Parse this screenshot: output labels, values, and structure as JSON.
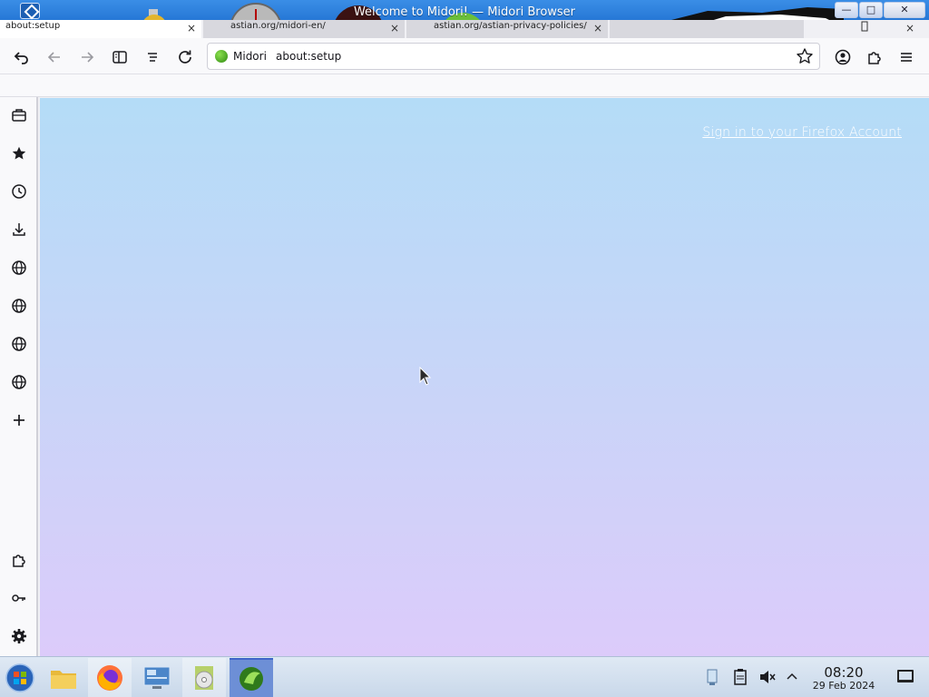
{
  "window": {
    "title": "Welcome to Midori! — Midori Browser",
    "controls": {
      "minimize": "—",
      "maximize": "□",
      "close": "✕"
    }
  },
  "tabs": [
    {
      "label": "about:setup",
      "active": true
    },
    {
      "label": "astian.org/midori-en/",
      "active": false
    },
    {
      "label": "astian.org/astian-privacy-policies/",
      "active": false
    },
    {
      "label": "",
      "active": false
    }
  ],
  "tab_close": "×",
  "toolbar": {
    "icons": [
      "undo-icon",
      "back-icon",
      "forward-icon",
      "sidebar-toggle-icon",
      "reader-list-icon",
      "reload-icon",
      "account-icon",
      "extensions-icon",
      "menu-icon"
    ]
  },
  "urlbar": {
    "site_name": "Midori",
    "url": "about:setup"
  },
  "sidebar": {
    "top_icons": [
      "briefcase-icon",
      "bookmarks-star-icon",
      "history-clock-icon",
      "downloads-icon",
      "web-panel-globe-icon",
      "web-panel-globe-icon",
      "web-panel-globe-icon",
      "web-panel-globe-icon",
      "add-panel-plus-icon"
    ],
    "bottom_icons": [
      "extensions-puzzle-icon",
      "passwords-key-icon",
      "settings-gear-icon"
    ]
  },
  "content": {
    "signin_link": "Sign in to your Firefox Account",
    "gradient_top": "#b4dcf7",
    "gradient_bottom": "#dccbfa"
  },
  "taskbar": {
    "items": [
      "start-orb-icon",
      "file-manager-icon",
      "firefox-icon",
      "control-panel-icon",
      "media-disc-icon",
      "midori-icon"
    ],
    "tray": [
      "network-icon",
      "clipboard-icon",
      "volume-muted-icon",
      "tray-expand-icon"
    ],
    "clock_time": "08:20",
    "clock_date": "29 Feb 2024"
  }
}
